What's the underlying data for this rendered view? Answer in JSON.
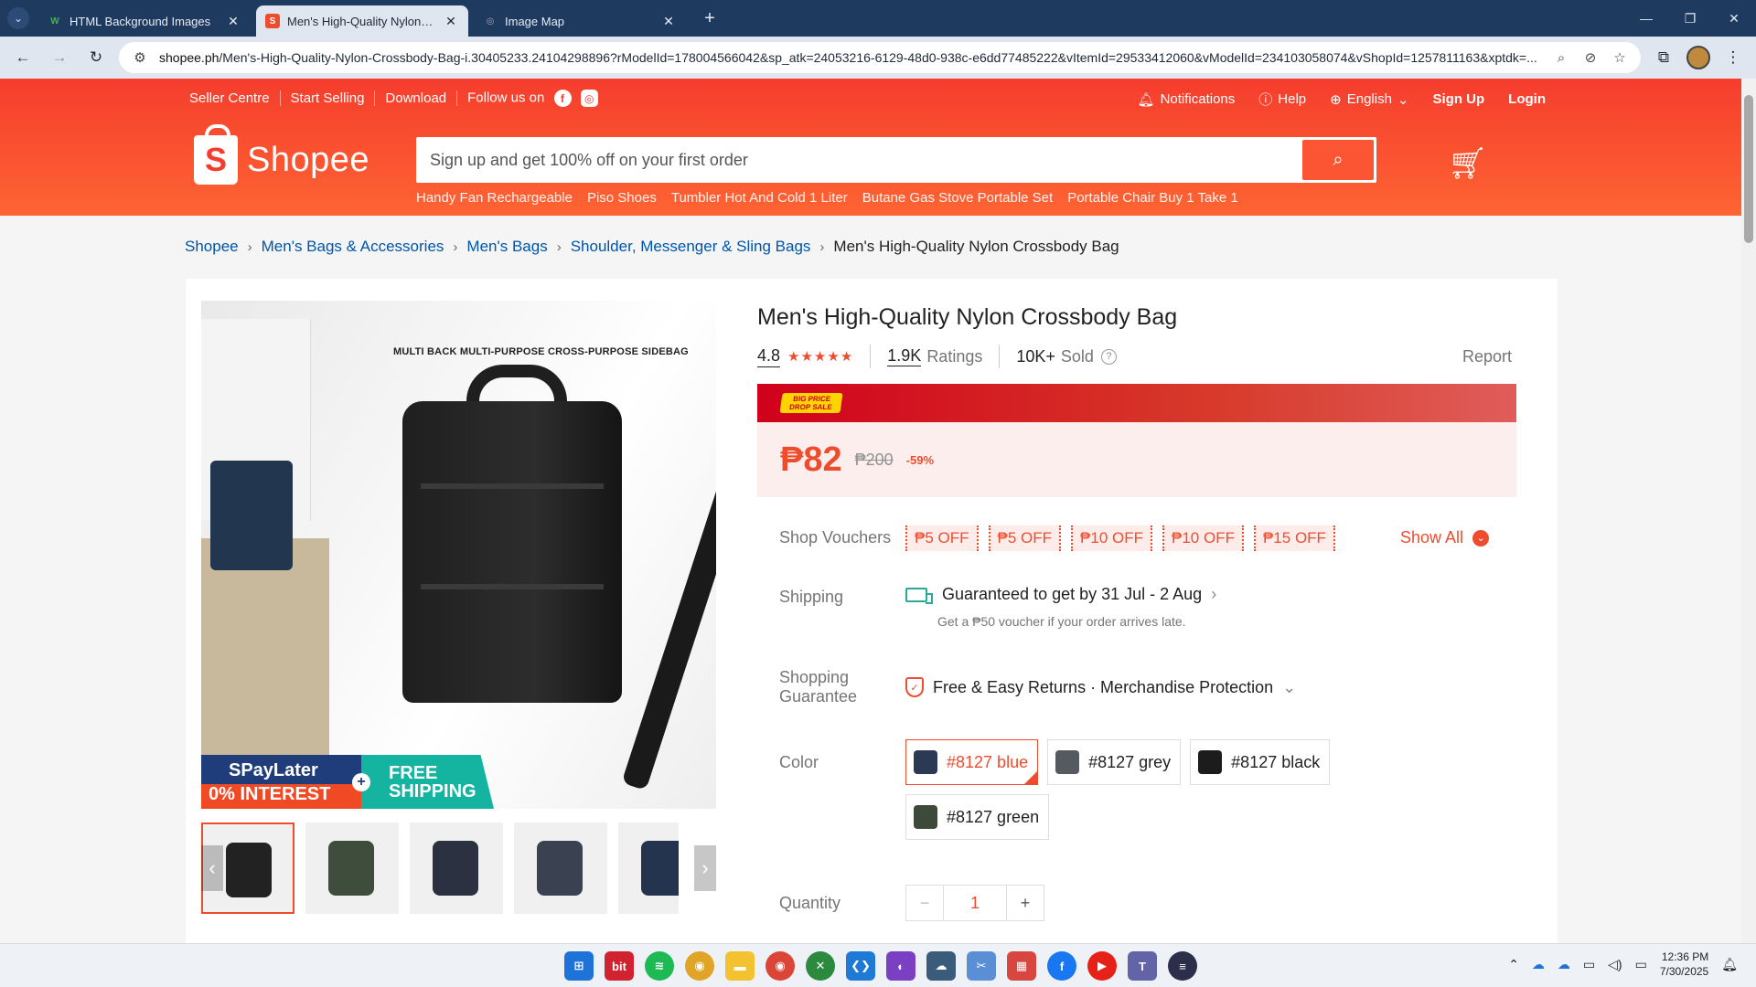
{
  "browser": {
    "tabs": [
      {
        "title": "HTML Background Images",
        "favicon": "W",
        "favicon_color": "#4caf50",
        "active": false
      },
      {
        "title": "Men's High-Quality Nylon Cros",
        "favicon": "S",
        "favicon_color": "#ee4d2d",
        "active": true
      },
      {
        "title": "Image Map",
        "favicon": "◎",
        "favicon_color": "#888888",
        "active": false
      }
    ],
    "url_domain": "shopee.ph",
    "url_path": "/Men's-High-Quality-Nylon-Crossbody-Bag-i.30405233.24104298896?rModelId=178004566042&sp_atk=24053216-6129-48d0-938c-e6dd77485222&vItemId=29533412060&vModelId=234103058074&vShopId=1257811163&xptdk=..."
  },
  "header": {
    "top_links": [
      "Seller Centre",
      "Start Selling",
      "Download"
    ],
    "follow_label": "Follow us on",
    "notifications": "Notifications",
    "help": "Help",
    "language": "English",
    "signup": "Sign Up",
    "login": "Login",
    "logo_text": "Shopee",
    "search_placeholder": "Sign up and get 100% off on your first order",
    "suggestions": [
      "Handy Fan Rechargeable",
      "Piso Shoes",
      "Tumbler Hot And Cold 1 Liter",
      "Butane Gas Stove Portable Set",
      "Portable Chair Buy 1 Take 1"
    ]
  },
  "breadcrumb": [
    "Shopee",
    "Men's Bags & Accessories",
    "Men's Bags",
    "Shoulder, Messenger & Sling Bags"
  ],
  "breadcrumb_current": "Men's High-Quality Nylon Crossbody Bag",
  "gallery": {
    "caption": "MULTI BACK MULTI-PURPOSE CROSS-PURPOSE SIDEBAG",
    "promo_left_top": "SPayLater",
    "promo_left_bottom": "0% INTEREST",
    "promo_right": "FREE SHIPPING",
    "thumb_colors": [
      "#222222",
      "#3f4e3c",
      "#2b3140",
      "#3a4150",
      "#24344f"
    ]
  },
  "product": {
    "title": "Men's High-Quality Nylon Crossbody Bag",
    "rating": "4.8",
    "stars": "★★★★★",
    "ratings_count": "1.9K",
    "ratings_label": "Ratings",
    "sold_count": "10K+",
    "sold_label": "Sold",
    "report": "Report",
    "flash_badge": "BIG PRICE DROP SALE",
    "price": "₱82",
    "original_price": "₱200",
    "discount": "-59%"
  },
  "details": {
    "vouchers_label": "Shop Vouchers",
    "vouchers": [
      "₱5 OFF",
      "₱5 OFF",
      "₱10 OFF",
      "₱10 OFF",
      "₱15 OFF"
    ],
    "show_all": "Show All",
    "shipping_label": "Shipping",
    "shipping_text": "Guaranteed to get by 31 Jul - 2 Aug",
    "shipping_sub": "Get a ₱50 voucher if your order arrives late.",
    "guarantee_label_1": "Shopping",
    "guarantee_label_2": "Guarantee",
    "guarantee_text": "Free & Easy Returns · Merchandise Protection",
    "color_label": "Color",
    "colors": [
      {
        "name": "#8127 blue",
        "swatch": "#2a3a55",
        "selected": true
      },
      {
        "name": "#8127 grey",
        "swatch": "#555a60",
        "selected": false
      },
      {
        "name": "#8127 black",
        "swatch": "#1c1c1c",
        "selected": false
      },
      {
        "name": "#8127 green",
        "swatch": "#3d4a3a",
        "selected": false
      }
    ],
    "quantity_label": "Quantity",
    "quantity": "1"
  },
  "taskbar": {
    "time": "12:36 PM",
    "date": "7/30/2025"
  }
}
